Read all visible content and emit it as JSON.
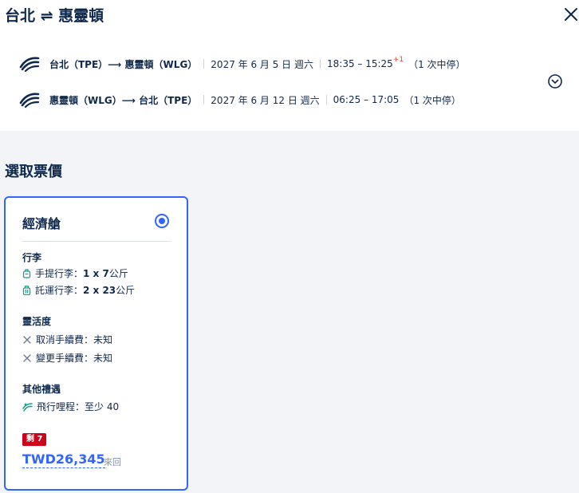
{
  "header": {
    "title": "台北 ⇌ 惠靈頓"
  },
  "segments": [
    {
      "route": "台北（TPE）⟶ 惠靈頓（WLG）",
      "date": "2027 年 6 月 5 日 週六",
      "time": "18:35 – 15:25",
      "day_offset": "+1",
      "stops": "（1 次中停）"
    },
    {
      "route": "惠靈頓（WLG）⟶ 台北（TPE）",
      "date": "2027 年 6 月 12 日 週六",
      "time": "06:25 – 17:05",
      "day_offset": "",
      "stops": "（1 次中停）"
    }
  ],
  "fare_section": {
    "title": "選取票價"
  },
  "fare_card": {
    "cabin": "經濟艙",
    "baggage_heading": "行李",
    "carry_on_label": "手提行李：",
    "carry_on_value": "1 x 7",
    "carry_on_unit": " 公斤",
    "checked_label": "託運行李：",
    "checked_value": "2 x 23",
    "checked_unit": " 公斤",
    "flex_heading": "靈活度",
    "cancel_fee": "取消手續費：未知",
    "change_fee": "變更手續費：未知",
    "perks_heading": "其他禮遇",
    "miles": "飛行哩程：至少 40",
    "seats_left_badge": "剩 7",
    "price": "TWD26,345",
    "trip_type": "來回"
  },
  "colors": {
    "accent": "#3264ff",
    "text": "#0f294d",
    "badge": "#d0021b",
    "secondary": "#8592a6"
  },
  "icons": [
    "close-icon",
    "airline-logo-icon",
    "chevron-down-circle-icon",
    "carry-on-bag-icon",
    "checked-bag-icon",
    "cross-icon",
    "miles-icon"
  ]
}
